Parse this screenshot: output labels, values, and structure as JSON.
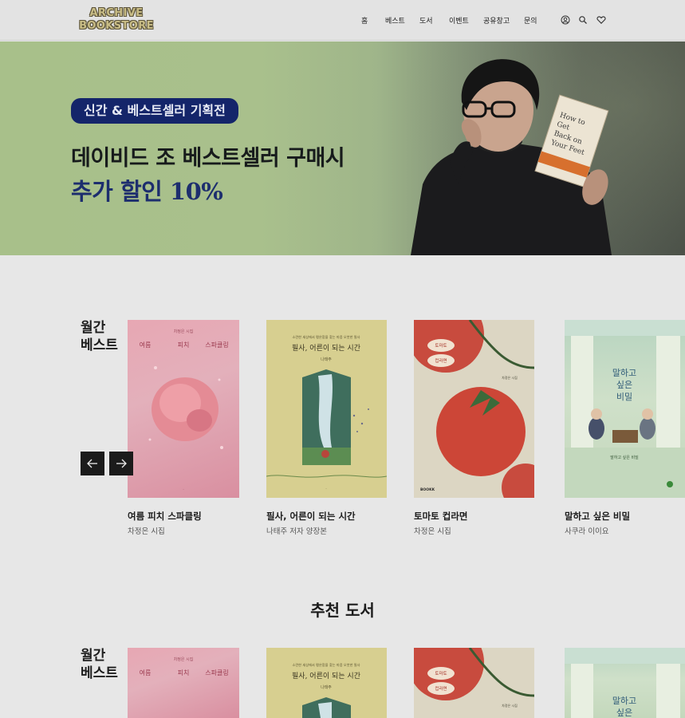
{
  "header": {
    "logo_line1": "ARCHIVE",
    "logo_line2": "BOOKSTORE",
    "nav": [
      "홈",
      "베스트",
      "도서",
      "이벤트",
      "공유창고",
      "문의"
    ],
    "icons": [
      "user-icon",
      "search-icon",
      "heart-icon"
    ]
  },
  "hero": {
    "badge": "신간 & 베스트셀러 기획전",
    "line1": "데이비드 조 베스트셀러 구매시",
    "line2": "추가 할인 10%",
    "book_text": "How to Get Back on Your Feet"
  },
  "monthly_best": {
    "label_line1": "월간",
    "label_line2": "베스트",
    "prev_icon": "arrow-left-icon",
    "next_icon": "arrow-right-icon",
    "books": [
      {
        "title": "여름 피치 스파클링",
        "sub": "차정은 시집",
        "cover": [
          "차정은 시집",
          "여름",
          "피치",
          "스파클링"
        ]
      },
      {
        "title": "필사, 어른이 되는 시간",
        "sub": "나태주 저자 양장본",
        "cover": [
          "소란한 세상에서 평온함을 찾는 마음 오븟한 필사",
          "필사, 어른이 되는 시간",
          "나태주"
        ]
      },
      {
        "title": "토마토 컵라면",
        "sub": "차정은 시집",
        "cover": [
          "토마토",
          "컵라면",
          "차정은 시집",
          "BOOKK"
        ]
      },
      {
        "title": "말하고 싶은 비밀",
        "sub": "사쿠라 이이요",
        "cover": [
          "말하고",
          "싶은",
          "비밀",
          "말하고 싶은 비밀"
        ]
      }
    ]
  },
  "recommend": {
    "title": "추천 도서",
    "label_line1": "월간",
    "label_line2": "베스트"
  }
}
